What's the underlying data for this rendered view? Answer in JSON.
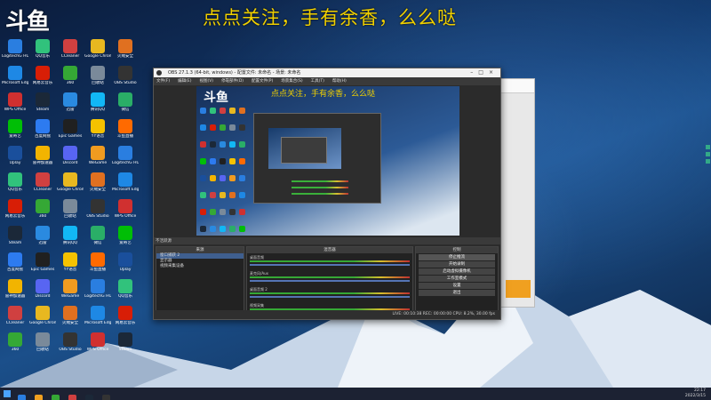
{
  "overlay": {
    "logo_text": "斗鱼",
    "caption": "点点关注，手有余香，么么哒"
  },
  "desktop_icons": [
    {
      "label": "LogitechG HUB",
      "color": "#2a7ee0"
    },
    {
      "label": "QQ音乐",
      "color": "#31c27c"
    },
    {
      "label": "CCleaner",
      "color": "#d04040"
    },
    {
      "label": "Google Chrome",
      "color": "#e8b820"
    },
    {
      "label": "火绒安全",
      "color": "#e07020"
    },
    {
      "label": "Microsoft Edge",
      "color": "#1e88e5"
    },
    {
      "label": "网易云音乐",
      "color": "#d81e06"
    },
    {
      "label": "360",
      "color": "#35a835"
    },
    {
      "label": "回收站",
      "color": "#7a8a9a"
    },
    {
      "label": "OBS Studio",
      "color": "#333333"
    },
    {
      "label": "WPS Office",
      "color": "#d03030"
    },
    {
      "label": "Steam",
      "color": "#1b2838"
    },
    {
      "label": "迅雷",
      "color": "#2a8ae0"
    },
    {
      "label": "腾讯QQ",
      "color": "#12b7f5"
    },
    {
      "label": "微信",
      "color": "#2aae67"
    },
    {
      "label": "爱奇艺",
      "color": "#00be06"
    },
    {
      "label": "百度网盘",
      "color": "#2d7bf0"
    },
    {
      "label": "Epic Games",
      "color": "#202020"
    },
    {
      "label": "YY语音",
      "color": "#f5c200"
    },
    {
      "label": "斗鱼直播",
      "color": "#ff6a00"
    },
    {
      "label": "Uplay",
      "color": "#1a4f9c"
    },
    {
      "label": "雷神加速器",
      "color": "#f2b400"
    },
    {
      "label": "Discord",
      "color": "#5865f2"
    },
    {
      "label": "WeGame",
      "color": "#f09b20"
    }
  ],
  "obs": {
    "title": "OBS 27.1.3 (64-bit, windows) - 配置文件: 未命名 - 场景: 未命名",
    "menu": [
      "文件(F)",
      "编辑(E)",
      "视图(V)",
      "停靠部件(D)",
      "配置文件(P)",
      "场景集合(S)",
      "工具(T)",
      "帮助(H)"
    ],
    "preview_caption": "点点关注，手有余香，么么哒",
    "scene_bar_label": "不活跃源",
    "docks": {
      "scenes": "场景",
      "sources": "来源",
      "mixer": "混音器",
      "transitions": "转场",
      "controls": "控制"
    },
    "sources": [
      "窗口捕获 2",
      "显示器",
      "视频采集设备"
    ],
    "mixer_channels": [
      "桌面音频",
      "麦克风/Aux",
      "桌面音频 2",
      "视频采集"
    ],
    "controls": [
      "停止推流",
      "开始录制",
      "启动虚拟摄像机",
      "工作室模式",
      "设置",
      "退出"
    ],
    "status": "LIVE: 00:10:38   REC: 00:00:00   CPU: 8.2%, 30.00 fps"
  },
  "tray": {
    "time": "22:17",
    "date": "2022/3/15"
  }
}
